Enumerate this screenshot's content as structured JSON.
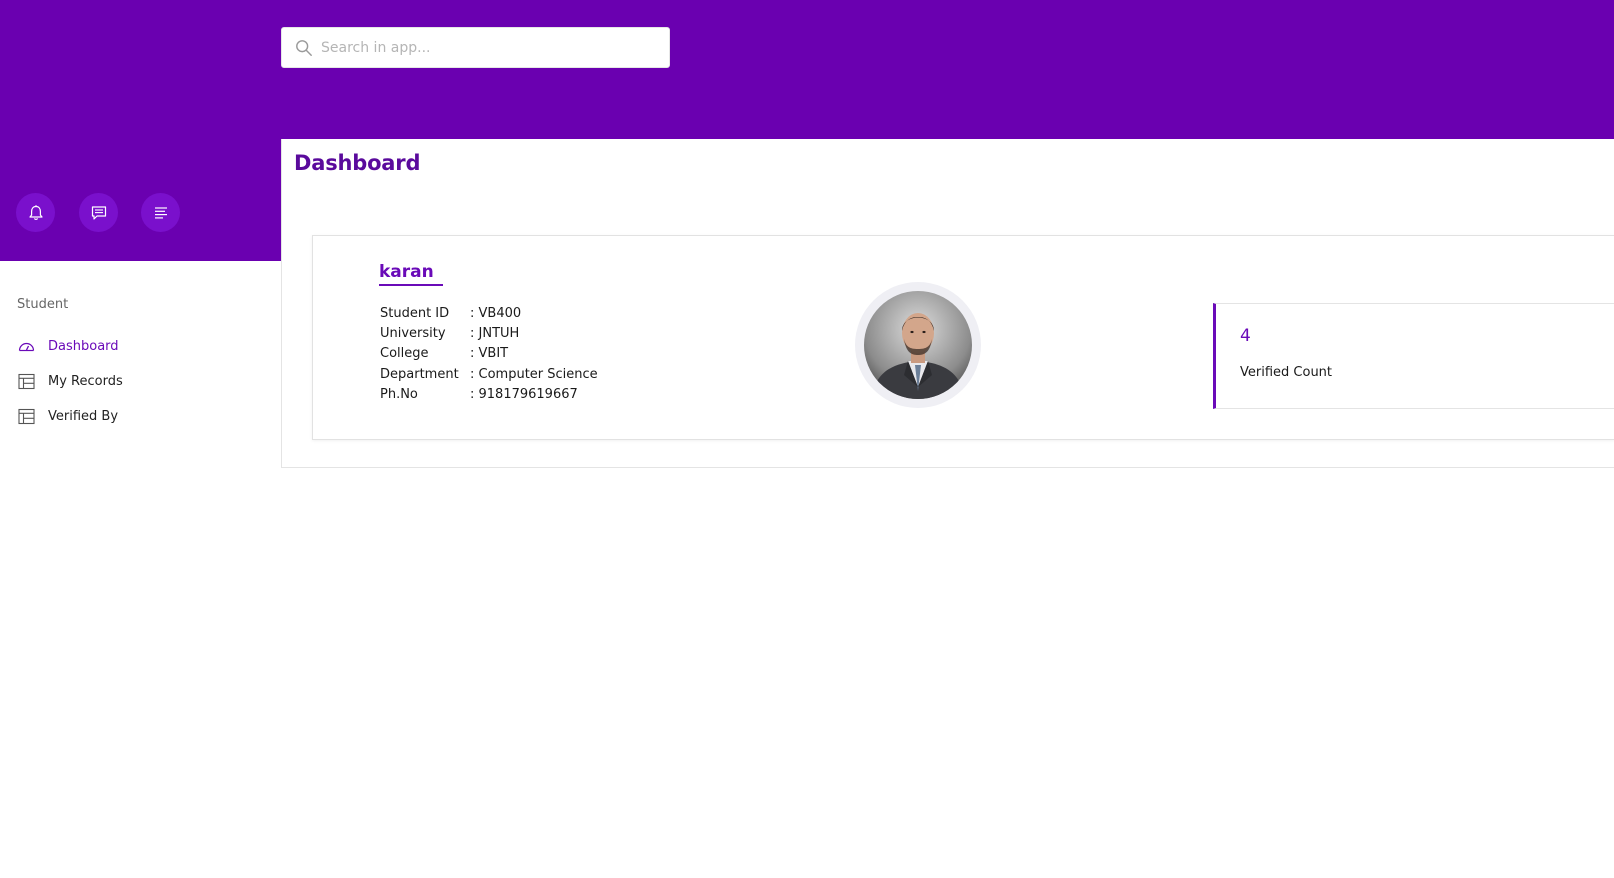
{
  "search": {
    "placeholder": "Search in app..."
  },
  "header_icons": [
    "bell-icon",
    "message-icon",
    "menu-lines-icon"
  ],
  "sidebar": {
    "section_title": "Student",
    "items": [
      {
        "label": "Dashboard",
        "icon": "dashboard-gauge-icon",
        "active": true
      },
      {
        "label": "My Records",
        "icon": "table-icon",
        "active": false
      },
      {
        "label": "Verified By",
        "icon": "table-icon",
        "active": false
      }
    ]
  },
  "main": {
    "title": "Dashboard",
    "student": {
      "name": "karan",
      "fields": [
        {
          "key": "Student ID",
          "value": ": VB400"
        },
        {
          "key": "University",
          "value": ": JNTUH"
        },
        {
          "key": "College",
          "value": ": VBIT"
        },
        {
          "key": "Department",
          "value": ": Computer Science"
        },
        {
          "key": "Ph.No",
          "value": ": 918179619667"
        }
      ]
    },
    "verified": {
      "count": "4",
      "label": "Verified Count"
    }
  },
  "colors": {
    "brand_purple": "#6a00b0",
    "accent_purple": "#6a0ab8",
    "title_purple": "#5a0a9c"
  }
}
